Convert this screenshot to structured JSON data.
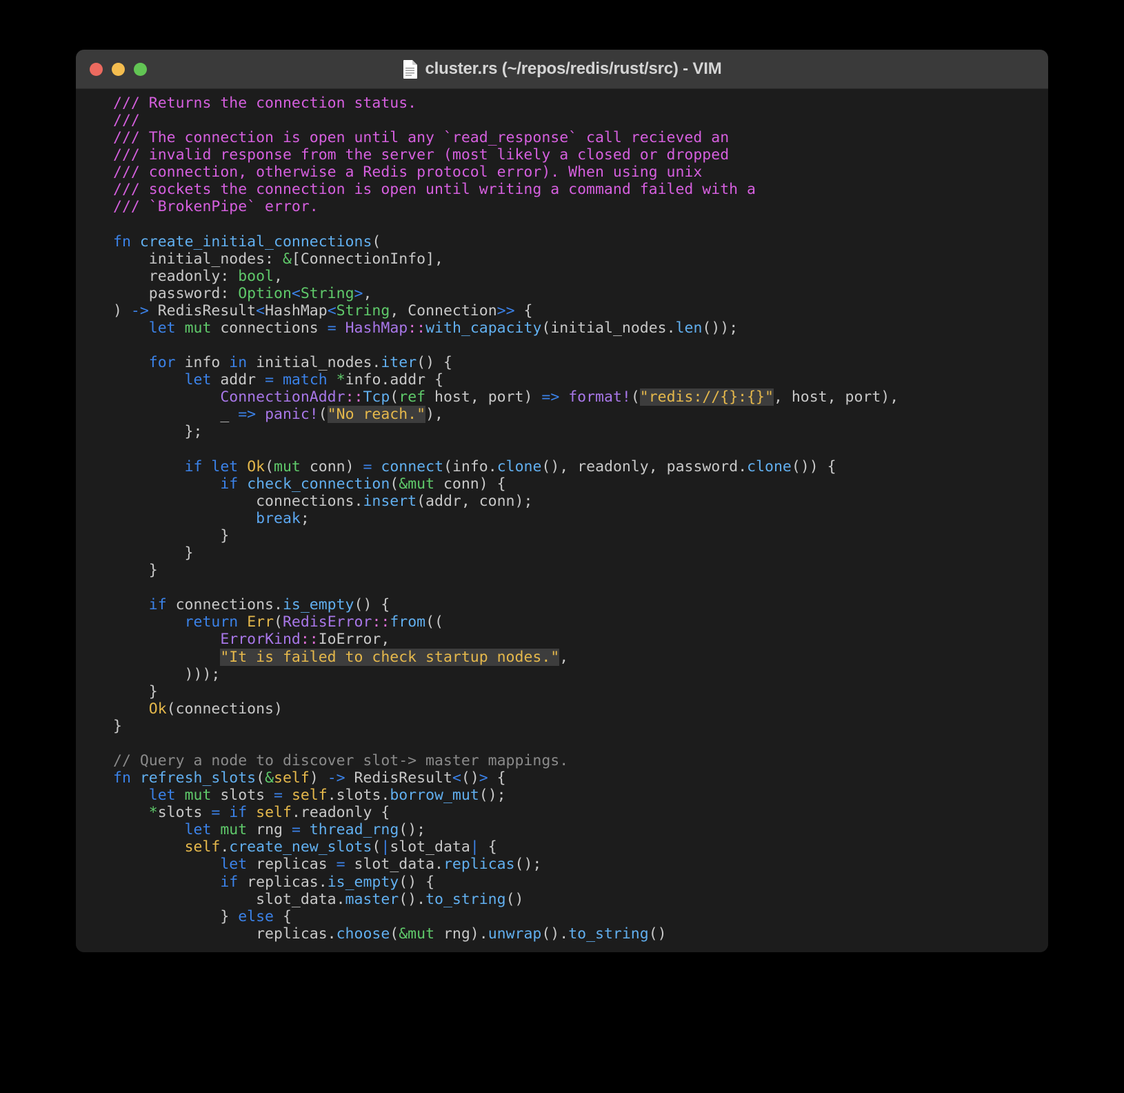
{
  "window": {
    "title": "cluster.rs (~/repos/redis/rust/src) - VIM",
    "filename": "cluster.rs",
    "directory": "~/repos/redis/rust/src",
    "application": "VIM",
    "doc_icon": "document-icon",
    "traffic_lights": [
      {
        "name": "close",
        "color": "#ec6a5f"
      },
      {
        "name": "minimize",
        "color": "#f4bd4f"
      },
      {
        "name": "maximize",
        "color": "#62c554"
      }
    ]
  },
  "theme": {
    "background": "#1c1c1c",
    "titlebar": "#3a3a3a",
    "desktop": "#000000",
    "foreground": "#c8c8c8",
    "doc_comment": "#d55fde",
    "line_comment": "#8a8a8a",
    "keyword": "#3b82e8",
    "function": "#61afef",
    "type": "#5fc96a",
    "module": "#a877e8",
    "separator": "#e06fd8",
    "constant": "#e5b84b",
    "string": "#e5b84b",
    "string_background": "#3d3d3d"
  },
  "editor": {
    "language": "rust",
    "font_size_px": 21.5,
    "lines": [
      "/// Returns the connection status.",
      "///",
      "/// The connection is open until any `read_response` call recieved an",
      "/// invalid response from the server (most likely a closed or dropped",
      "/// connection, otherwise a Redis protocol error). When using unix",
      "/// sockets the connection is open until writing a command failed with a",
      "/// `BrokenPipe` error.",
      "",
      "fn create_initial_connections(",
      "    initial_nodes: &[ConnectionInfo],",
      "    readonly: bool,",
      "    password: Option<String>,",
      ") -> RedisResult<HashMap<String, Connection>> {",
      "    let mut connections = HashMap::with_capacity(initial_nodes.len());",
      "",
      "    for info in initial_nodes.iter() {",
      "        let addr = match *info.addr {",
      "            ConnectionAddr::Tcp(ref host, port) => format!(\"redis://{}:{}\", host, port),",
      "            _ => panic!(\"No reach.\"),",
      "        };",
      "",
      "        if let Ok(mut conn) = connect(info.clone(), readonly, password.clone()) {",
      "            if check_connection(&mut conn) {",
      "                connections.insert(addr, conn);",
      "                break;",
      "            }",
      "        }",
      "    }",
      "",
      "    if connections.is_empty() {",
      "        return Err(RedisError::from((",
      "            ErrorKind::IoError,",
      "            \"It is failed to check startup nodes.\",",
      "        )));",
      "    }",
      "    Ok(connections)",
      "}",
      "",
      "// Query a node to discover slot-> master mappings.",
      "fn refresh_slots(&self) -> RedisResult<()> {",
      "    let mut slots = self.slots.borrow_mut();",
      "    *slots = if self.readonly {",
      "        let mut rng = thread_rng();",
      "        self.create_new_slots(|slot_data| {",
      "            let replicas = slot_data.replicas();",
      "            if replicas.is_empty() {",
      "                slot_data.master().to_string()",
      "            } else {",
      "                replicas.choose(&mut rng).unwrap().to_string()"
    ],
    "highlighted_strings": [
      "\"redis://{}:{}\"",
      "\"No reach.\"",
      "\"It is failed to check startup nodes.\""
    ]
  }
}
